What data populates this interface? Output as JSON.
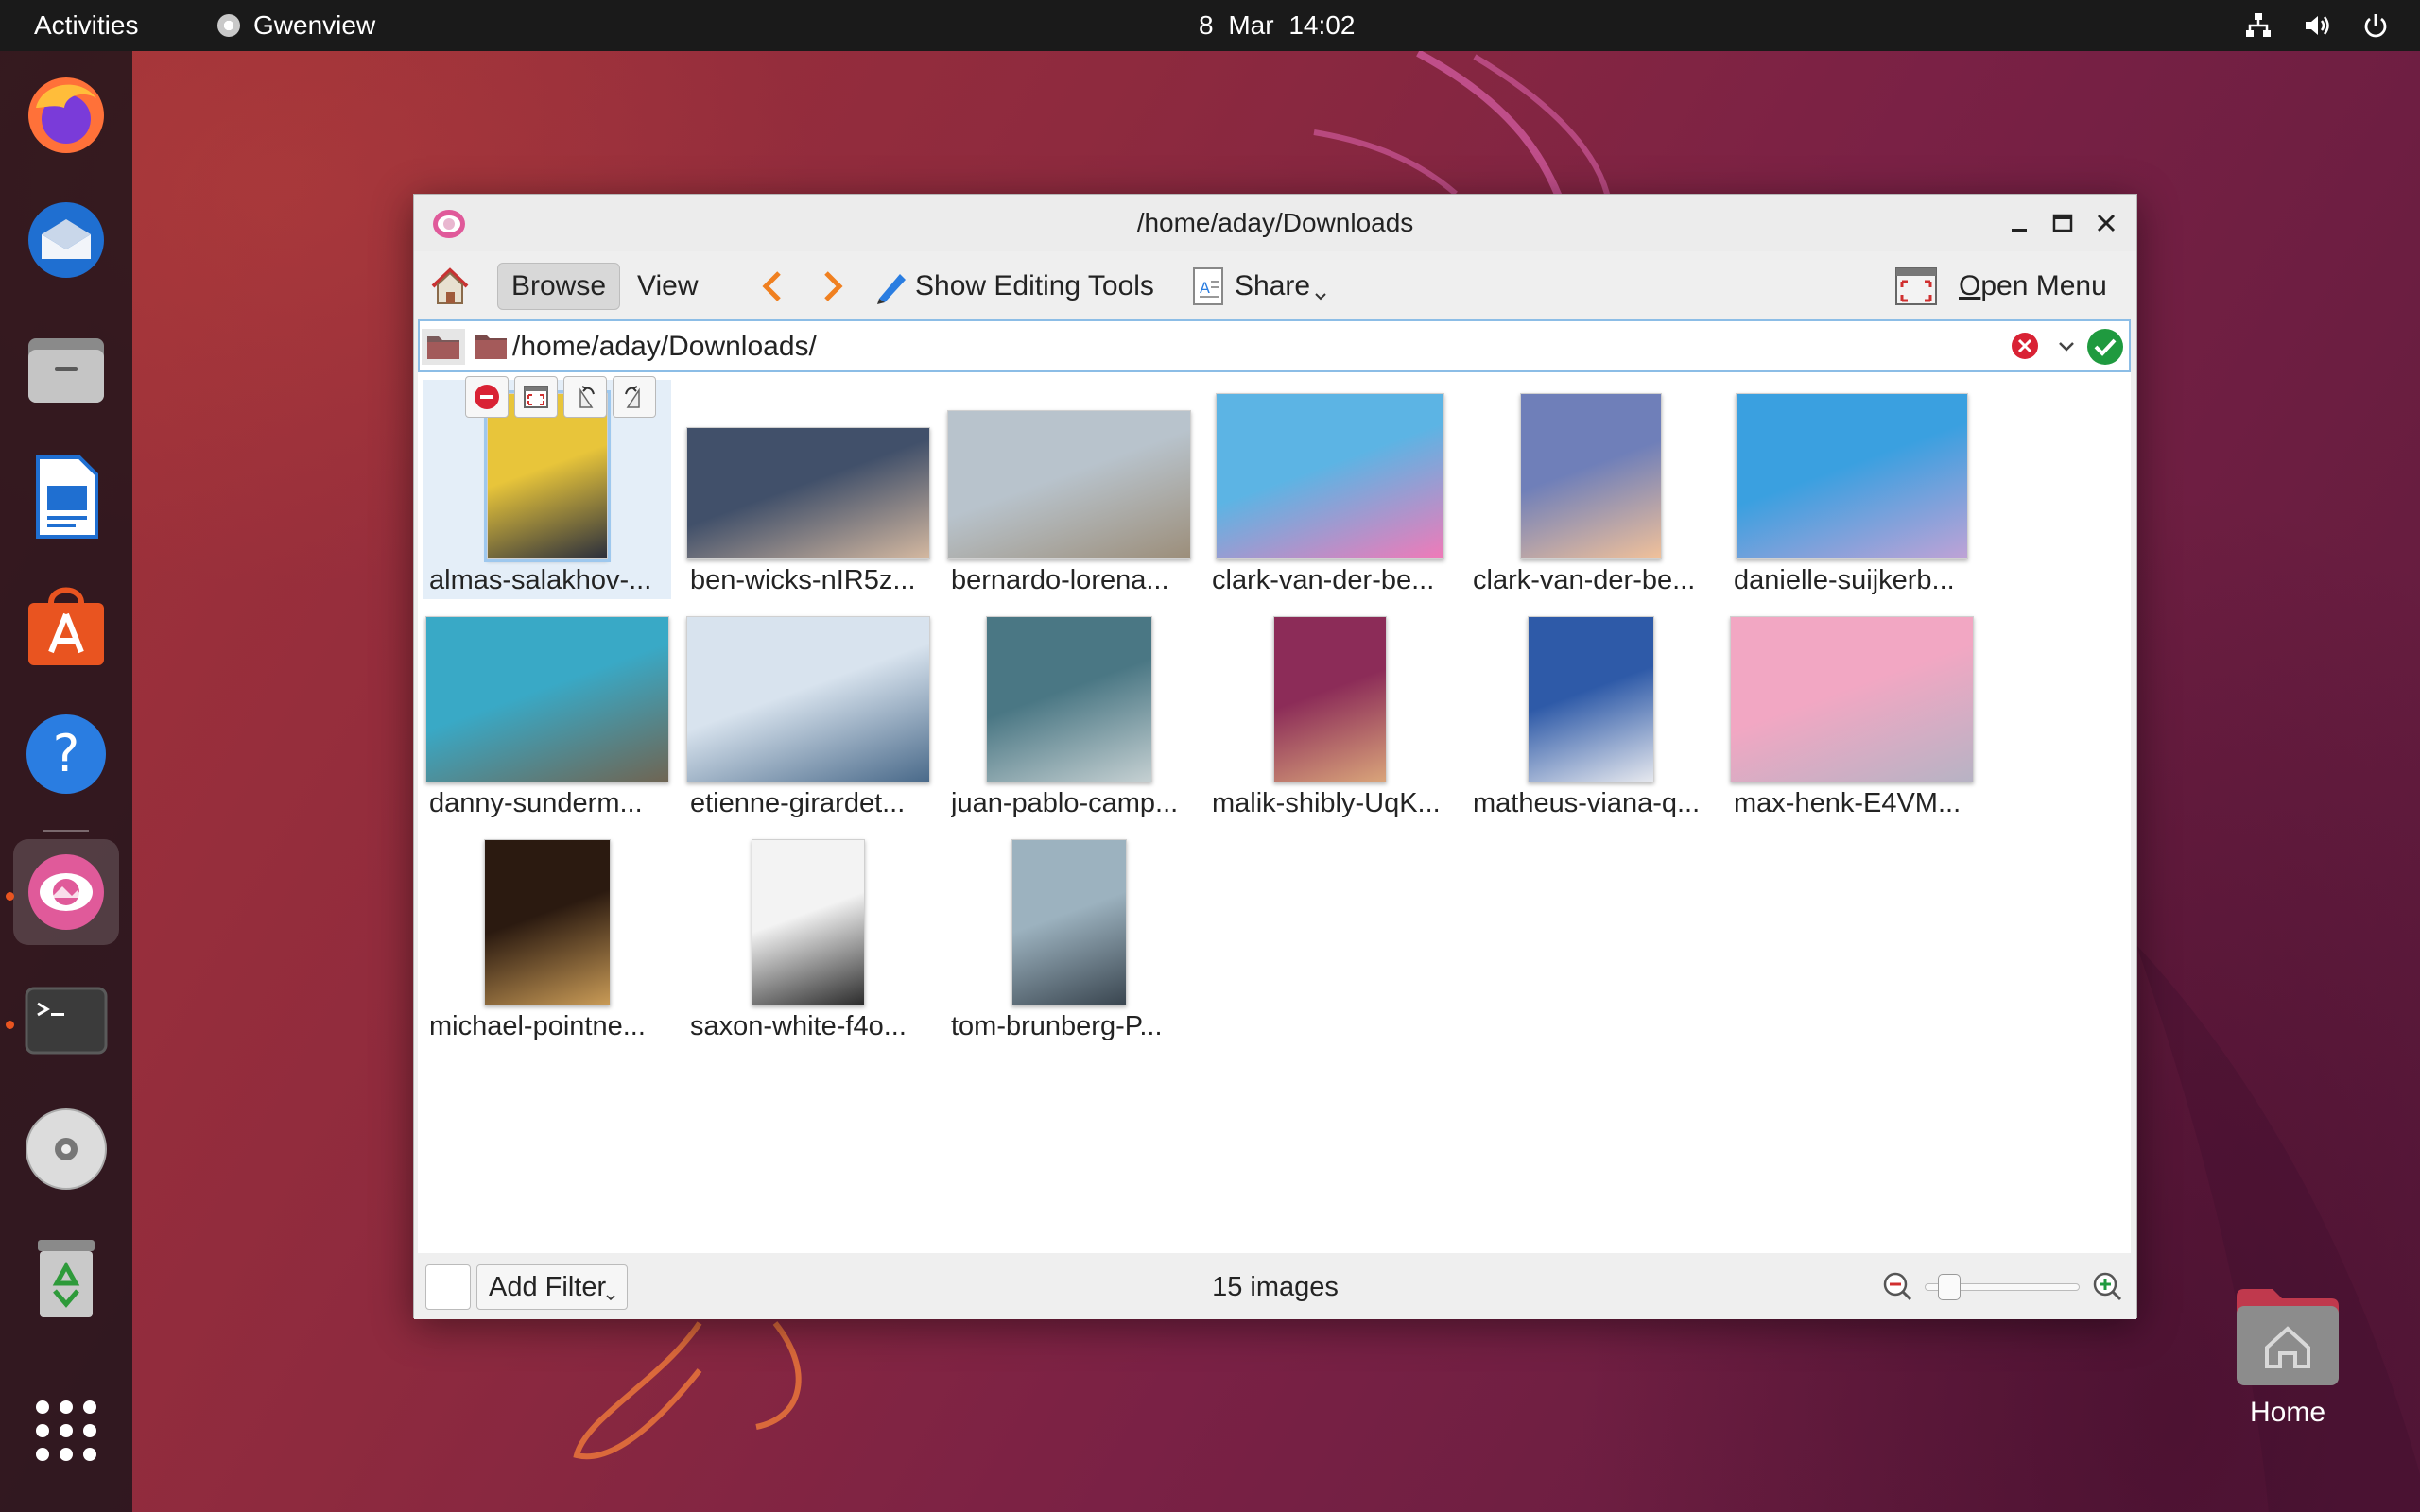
{
  "topbar": {
    "activities": "Activities",
    "app_name": "Gwenview",
    "date": "8 Mar",
    "time": "14:02"
  },
  "dock": {
    "items": [
      {
        "name": "firefox",
        "icon": "firefox-icon",
        "running": false
      },
      {
        "name": "thunderbird",
        "icon": "thunderbird-icon",
        "running": false
      },
      {
        "name": "files",
        "icon": "files-icon",
        "running": false
      },
      {
        "name": "libreoffice-writer",
        "icon": "writer-icon",
        "running": false
      },
      {
        "name": "software",
        "icon": "software-icon",
        "running": false
      },
      {
        "name": "help",
        "icon": "help-icon",
        "running": false
      },
      {
        "name": "gwenview",
        "icon": "gwenview-icon",
        "running": true,
        "active": true
      },
      {
        "name": "terminal",
        "icon": "terminal-icon",
        "running": true
      },
      {
        "name": "disc",
        "icon": "disc-icon",
        "running": false
      },
      {
        "name": "trash",
        "icon": "trash-icon",
        "running": false
      },
      {
        "name": "show-apps",
        "icon": "apps-grid-icon",
        "running": false
      }
    ]
  },
  "desktop": {
    "home_label": "Home"
  },
  "window": {
    "title": "/home/aday/Downloads",
    "toolbar": {
      "browse": "Browse",
      "view": "View",
      "show_editing_tools": "Show Editing Tools",
      "share": "Share",
      "open_menu_prefix": "O",
      "open_menu_rest": "pen Menu"
    },
    "location": {
      "path": "/home/aday/Downloads/"
    },
    "thumbnails": [
      {
        "caption": "almas-salakhov-...",
        "colors": [
          "#e8c53a",
          "#2b2f3c"
        ]
      },
      {
        "caption": "ben-wicks-nIR5z...",
        "colors": [
          "#41506a",
          "#d4b8a0"
        ]
      },
      {
        "caption": "bernardo-lorena...",
        "colors": [
          "#b8c3cc",
          "#9c8e7a"
        ]
      },
      {
        "caption": "clark-van-der-be...",
        "colors": [
          "#5cb4e4",
          "#f07ab8"
        ]
      },
      {
        "caption": "clark-van-der-be...",
        "colors": [
          "#6f7fb9",
          "#f1c19a"
        ]
      },
      {
        "caption": "danielle-suijkerb...",
        "colors": [
          "#3aa0e0",
          "#bfa2d6"
        ]
      },
      {
        "caption": "danny-sunderm...",
        "colors": [
          "#39a9c6",
          "#6f6553"
        ]
      },
      {
        "caption": "etienne-girardet...",
        "colors": [
          "#d8e3ee",
          "#4a6a8a"
        ]
      },
      {
        "caption": "juan-pablo-camp...",
        "colors": [
          "#4a7784",
          "#c5d0d2"
        ]
      },
      {
        "caption": "malik-shibly-UqK...",
        "colors": [
          "#8c2c58",
          "#d9a47a"
        ]
      },
      {
        "caption": "matheus-viana-q...",
        "colors": [
          "#2e5aa8",
          "#e6e8ee"
        ]
      },
      {
        "caption": "max-henk-E4VM...",
        "colors": [
          "#f2a7c3",
          "#b7b3c4"
        ]
      },
      {
        "caption": "michael-pointne...",
        "colors": [
          "#2b1a10",
          "#c89a56"
        ]
      },
      {
        "caption": "saxon-white-f4o...",
        "colors": [
          "#f3f3f3",
          "#2d2d2d"
        ]
      },
      {
        "caption": "tom-brunberg-P...",
        "colors": [
          "#9cb2bf",
          "#3a4650"
        ]
      }
    ],
    "status": {
      "add_filter": "Add Filter",
      "count": "15 images",
      "zoom_level": 0.1
    }
  }
}
